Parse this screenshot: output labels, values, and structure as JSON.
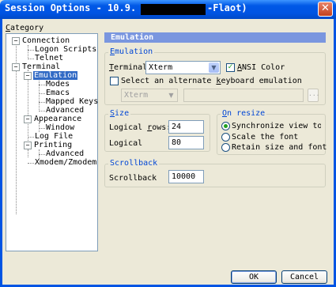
{
  "window": {
    "title_prefix": "Session Options - 10.9.",
    "title_suffix": "-Flaot)",
    "close_glyph": "✕"
  },
  "category": {
    "label_u": "C",
    "label_rest": "ategory",
    "tree": {
      "connection": "Connection",
      "logon_scripts": "Logon Scripts",
      "telnet": "Telnet",
      "terminal": "Terminal",
      "emulation": "Emulation",
      "modes": "Modes",
      "emacs": "Emacs",
      "mapped_keys": "Mapped Keys",
      "advanced": "Advanced",
      "appearance": "Appearance",
      "window": "Window",
      "log_file": "Log File",
      "printing": "Printing",
      "printing_advanced": "Advanced",
      "xmodem": "Xmodem/Zmodem"
    },
    "toggle_minus": "−"
  },
  "panel": {
    "header": "Emulation",
    "emulation_group": {
      "title_u": "E",
      "title_rest": "mulation",
      "terminal_label_u": "T",
      "terminal_label_rest": "erminal",
      "terminal_value": "Xterm",
      "ansi_color_u": "A",
      "ansi_color_rest": "NSI Color",
      "ansi_checked": true,
      "alt_keyboard_label": "Select an alternate keyboard emulation",
      "alt_keyboard_underline": "k",
      "alt_keyboard_before": "Select an alternate ",
      "alt_keyboard_after": "eyboard emulation",
      "alt_select_value": "Xterm",
      "browse_label": "..."
    },
    "size_group": {
      "title_u": "S",
      "title_rest": "ize",
      "rows_label_before": "Logical ",
      "rows_label_u": "r",
      "rows_label_after": "ows:",
      "rows_value": "24",
      "cols_label": "Logical",
      "cols_value": "80"
    },
    "resize_group": {
      "title_before": "",
      "title_u": "O",
      "title_rest": "n resize",
      "options": [
        {
          "label": "Synchronize view to siz",
          "selected": true,
          "u_index": 0
        },
        {
          "label": "Scale the font",
          "selected": false
        },
        {
          "label": "Retain size and font",
          "selected": false
        }
      ]
    },
    "scrollback_group": {
      "title": "Scrollback",
      "label": "Scrollback",
      "value": "10000"
    }
  },
  "buttons": {
    "ok": "OK",
    "cancel": "Cancel"
  },
  "icons": {
    "dropdown": "chevron-down-icon",
    "check": "checkmark-icon"
  },
  "colors": {
    "titlebar": "#0054e3",
    "header_bar": "#7a96df",
    "group_title": "#0046d5",
    "selection": "#316ac5"
  }
}
